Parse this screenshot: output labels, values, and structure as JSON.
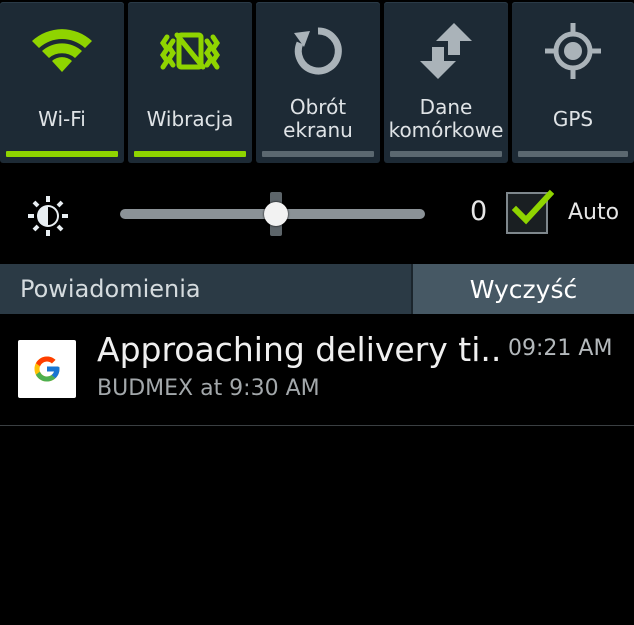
{
  "quick_settings": {
    "tiles": [
      {
        "label": "Wi-Fi",
        "icon": "wifi-icon",
        "active": true
      },
      {
        "label": "Wibracja",
        "icon": "vibrate-icon",
        "active": true
      },
      {
        "label_line1": "Obrót",
        "label_line2": "ekranu",
        "icon": "rotate-icon",
        "active": false
      },
      {
        "label_line1": "Dane",
        "label_line2": "komórkowe",
        "icon": "mobile-data-icon",
        "active": false
      },
      {
        "label": "GPS",
        "icon": "gps-icon",
        "active": false
      }
    ],
    "accent_color": "#8fd400"
  },
  "brightness": {
    "level_fraction": 0.5,
    "value": "0",
    "auto_label": "Auto",
    "auto_checked": true
  },
  "notifications": {
    "header_title": "Powiadomienia",
    "clear_label": "Wyczyść",
    "items": [
      {
        "app_icon": "google-icon",
        "title": "Approaching delivery ti..",
        "subtitle": "BUDMEX at 9:30 AM",
        "time": "09:21 AM"
      }
    ]
  }
}
